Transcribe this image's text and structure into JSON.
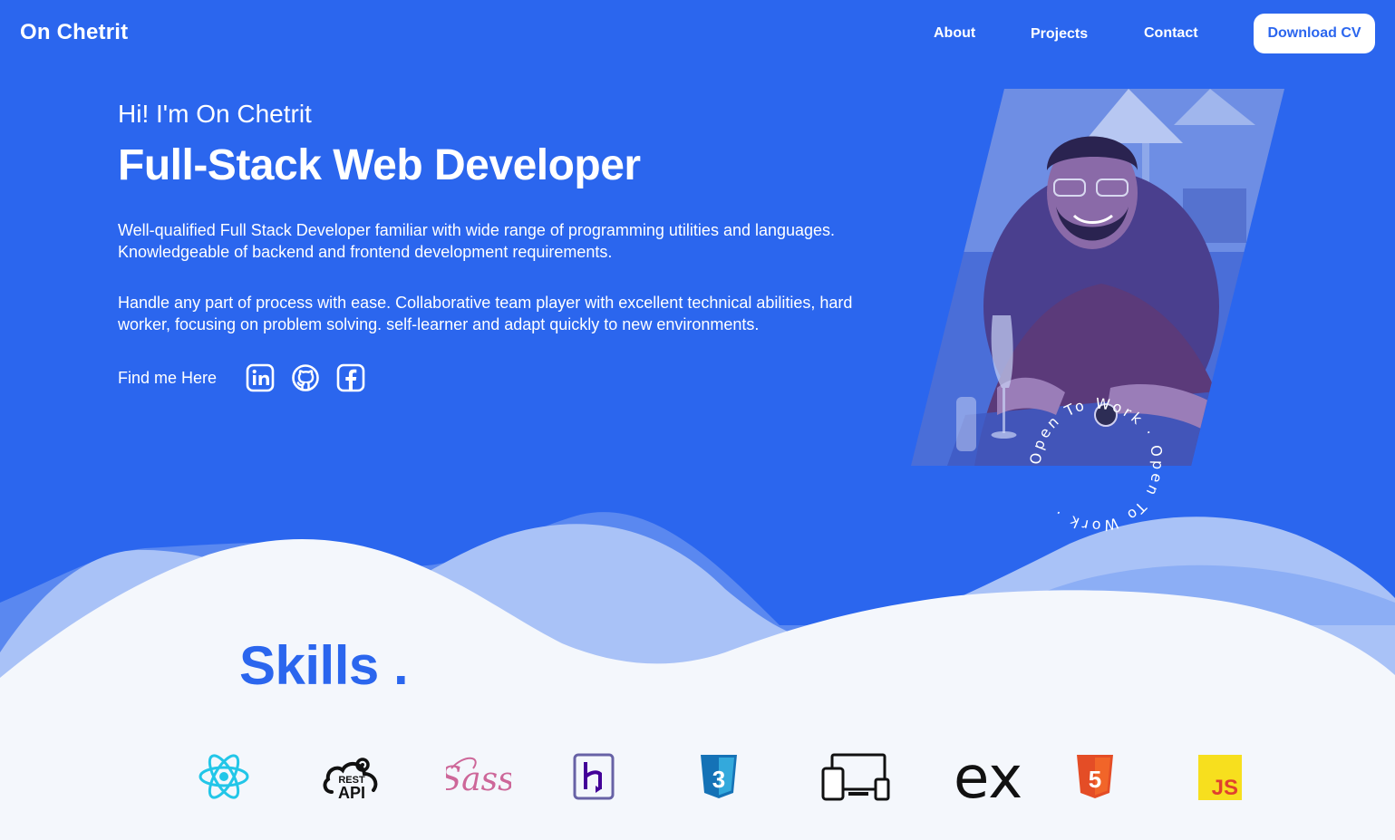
{
  "nav": {
    "logo": "On Chetrit",
    "links": [
      {
        "label": "About"
      },
      {
        "label": "Projects"
      },
      {
        "label": "Contact"
      }
    ],
    "cta_label": "Download CV"
  },
  "hero": {
    "greeting": "Hi! I'm On Chetrit",
    "title": "Full-Stack Web Developer",
    "paragraph_1": "Well-qualified Full Stack Developer familiar with wide range of programming utilities and languages. Knowledgeable of backend and frontend development requirements.",
    "paragraph_2": "Handle any part of process with ease. Collaborative team player with excellent technical abilities, hard worker, focusing on problem solving. self-learner and adapt quickly to new environments.",
    "find_me_label": "Find me Here",
    "social_icons": [
      "linkedin-icon",
      "github-icon",
      "facebook-icon"
    ],
    "badge_text": "Open To Work · Open To Work · "
  },
  "skills": {
    "title": "Skills .",
    "icons": [
      "react-icon",
      "rest-api-icon",
      "sass-icon",
      "heroku-icon",
      "css3-icon",
      "responsive-devices-icon",
      "express-icon",
      "html5-icon",
      "javascript-icon"
    ],
    "rest_api_text_top": "REST",
    "rest_api_text_bottom": "API",
    "sass_text": "Sass",
    "express_text": "ex",
    "js_text": "JS",
    "css_text": "3",
    "html_text": "5"
  },
  "colors": {
    "brand": "#2b66ee",
    "background": "#f4f7fc",
    "wave_light": "#a9c2f7",
    "wave_mid": "#5a88f0"
  }
}
